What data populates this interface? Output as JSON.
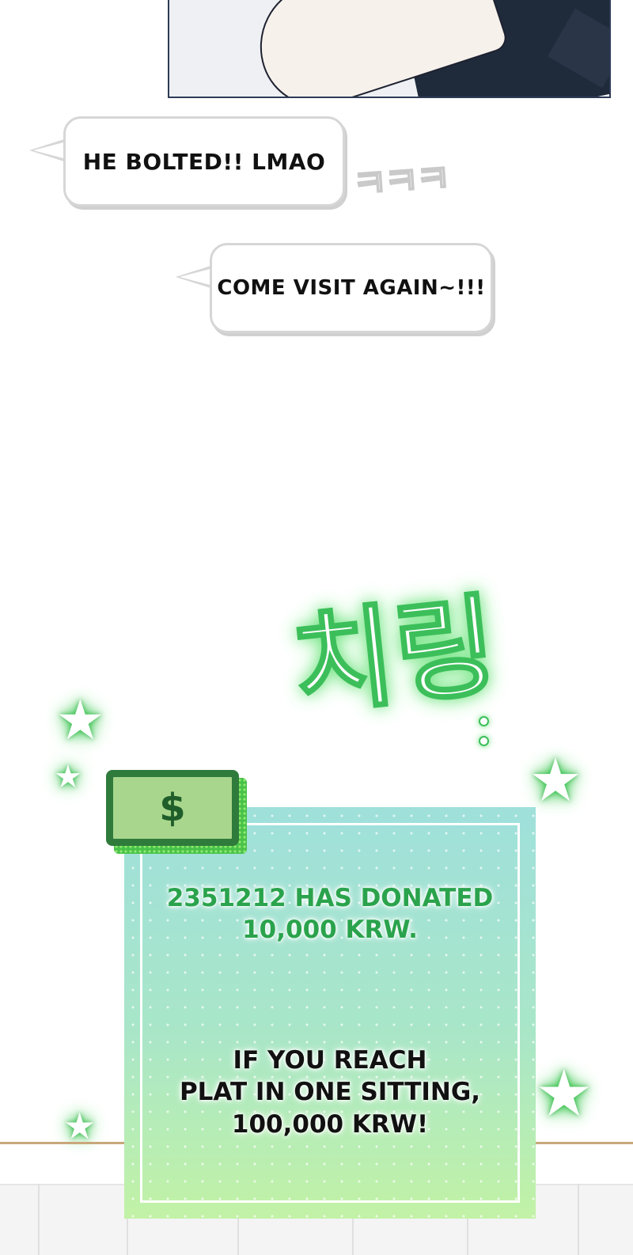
{
  "bubbles": {
    "first": "HE BOLTED!! LMAO",
    "second": "COME VISIT AGAIN~!!!"
  },
  "sfx": {
    "laugh": "ㅋㅋㅋ",
    "chiring": "치링"
  },
  "money_icon": {
    "symbol": "$"
  },
  "donation": {
    "line1": "2351212 HAS DONATED\n10,000 KRW.",
    "line2": "IF YOU REACH\nPLAT IN ONE SITTING,\n100,000 KRW!"
  },
  "star_symbol": "★",
  "colors": {
    "glow_green": "#3cbf5a",
    "text_green": "#2aa34c",
    "card_top": "#9fe0db",
    "card_bottom": "#c2f2a6"
  }
}
